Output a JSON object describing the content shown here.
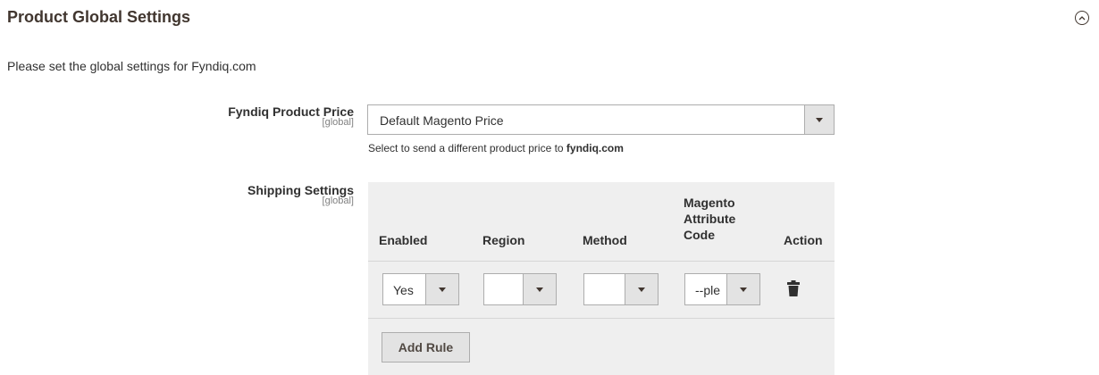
{
  "section": {
    "title": "Product Global Settings",
    "description": "Please set the global settings for Fyndiq.com"
  },
  "price_field": {
    "label": "Fyndiq Product Price",
    "scope": "[global]",
    "selected": "Default Magento Price",
    "note_prefix": "Select to send a different product price to ",
    "note_bold": "fyndiq.com"
  },
  "shipping_field": {
    "label": "Shipping Settings",
    "scope": "[global]",
    "columns": {
      "enabled": "Enabled",
      "region": "Region",
      "method": "Method",
      "magento_attr_line1": "Magento",
      "magento_attr_line2": "Attribute",
      "magento_attr_line3": "Code",
      "action": "Action"
    },
    "row": {
      "enabled": "Yes",
      "region": "",
      "method": "",
      "attribute_code": "--ple"
    },
    "add_rule_label": "Add Rule"
  },
  "icons": {
    "collapse": "chevron-up-circle-icon",
    "delete": "trash-icon",
    "dropdown": "caret-down-icon"
  }
}
